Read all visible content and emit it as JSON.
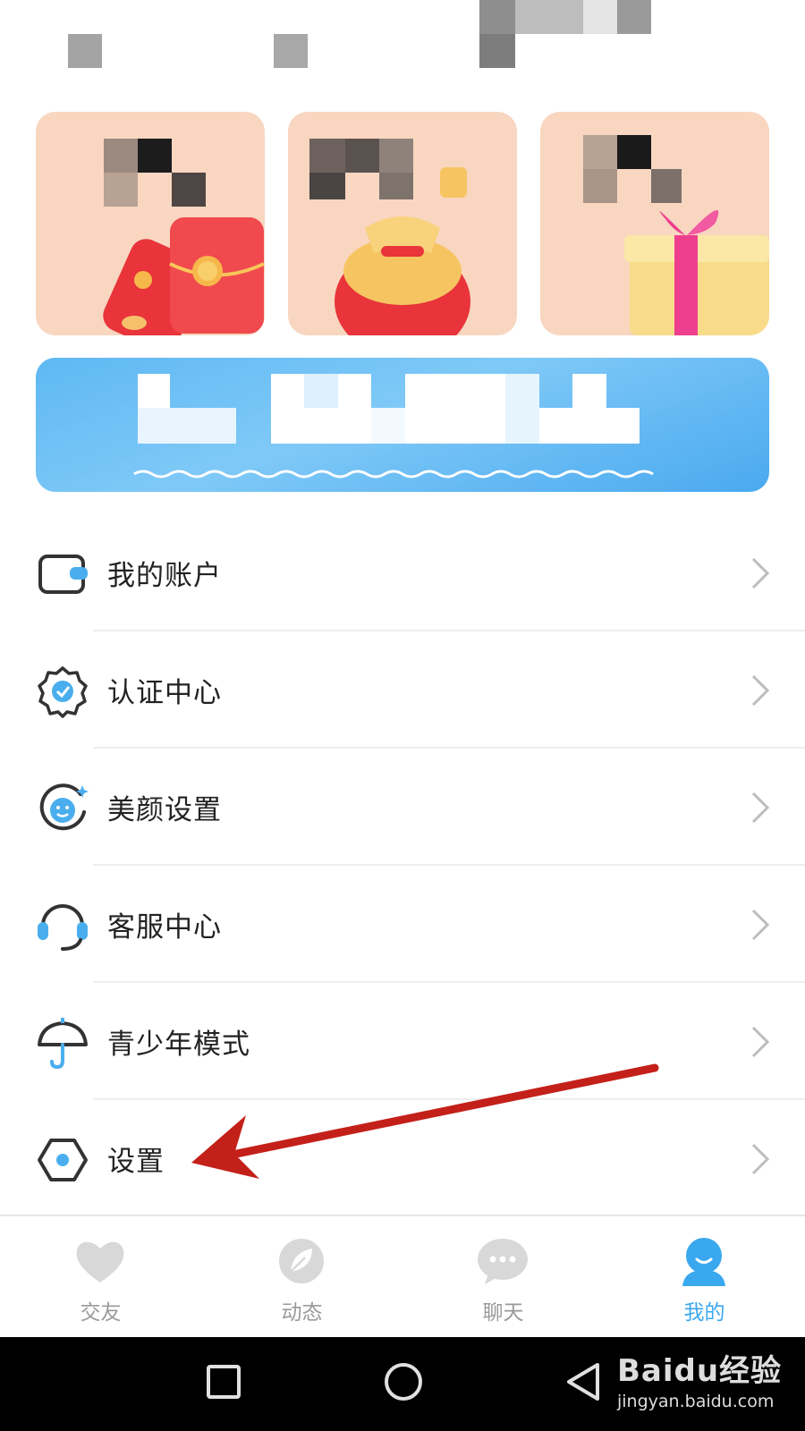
{
  "menu": {
    "items": [
      {
        "label": "我的账户",
        "icon": "wallet-icon"
      },
      {
        "label": "认证中心",
        "icon": "verified-badge-icon"
      },
      {
        "label": "美颜设置",
        "icon": "beauty-face-icon"
      },
      {
        "label": "客服中心",
        "icon": "headset-icon"
      },
      {
        "label": "青少年模式",
        "icon": "umbrella-icon"
      },
      {
        "label": "设置",
        "icon": "hexagon-settings-icon"
      }
    ]
  },
  "tabbar": {
    "tabs": [
      {
        "label": "交友",
        "icon": "heart-icon"
      },
      {
        "label": "动态",
        "icon": "leaf-icon"
      },
      {
        "label": "聊天",
        "icon": "chat-bubble-icon"
      },
      {
        "label": "我的",
        "icon": "person-icon",
        "active": true
      }
    ]
  },
  "watermark": {
    "brand": "Baidu经验",
    "url": "jingyan.baidu.com"
  },
  "colors": {
    "accent": "#3aa8ee",
    "card_bg": "#f8d6c0",
    "arrow": "#c4201a",
    "inactive": "#9a9a9a"
  }
}
